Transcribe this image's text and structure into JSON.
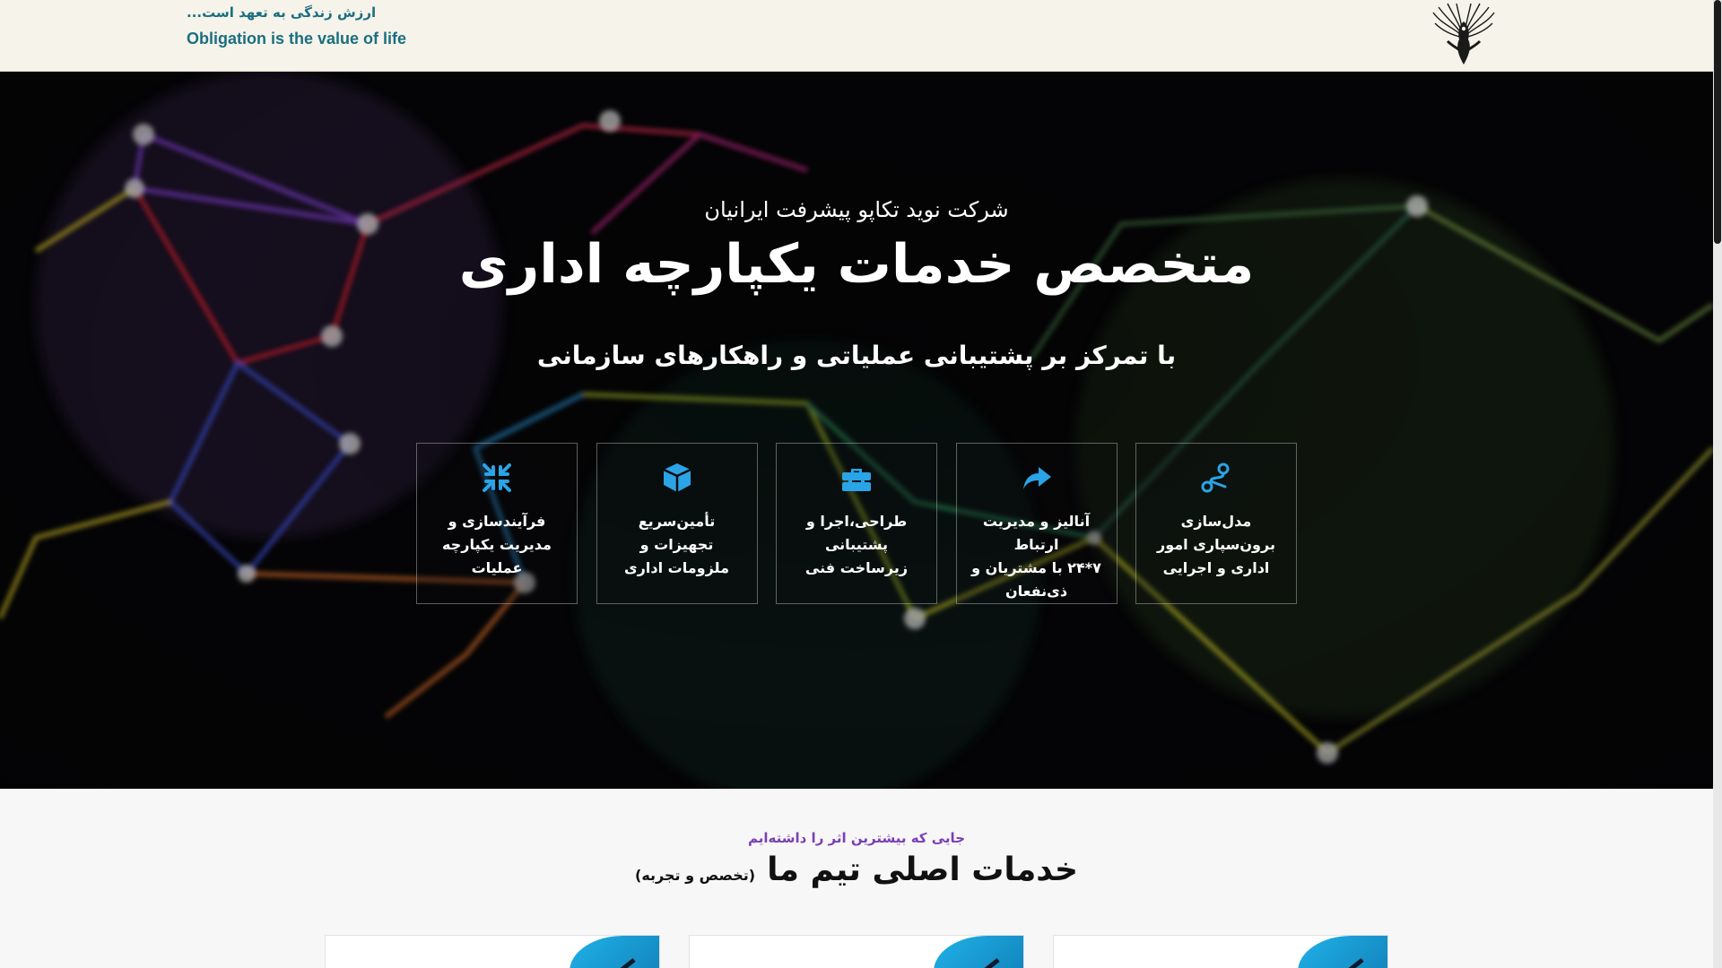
{
  "header": {
    "tagline_fa": "ارزش زندگی به تعهد است...",
    "tagline_en": "Obligation is the value of life",
    "logo_icon": "phoenix-emblem-icon"
  },
  "hero": {
    "company_name": "شرکت نوید تکاپو پیشرفت ایرانیان",
    "title": "متخصص خدمات یکپارچه اداری",
    "focus": "با تمرکز بر پشتیبانی عملیاتی و راهکارهای سازمانی",
    "features": [
      {
        "icon": "route-icon",
        "label": "مدل‌سازی\nبرون‌سپاری امور\nاداری و اجرایی"
      },
      {
        "icon": "share-arrow-icon",
        "label": "آنالیز و مدیریت ارتباط\n۷*۲۴ با مشتریان و\nذی‌نفعان"
      },
      {
        "icon": "toolbox-icon",
        "label": "طراحی،اجرا و\nپشتیبانی\nزیرساخت فنی"
      },
      {
        "icon": "cube-icon",
        "label": "تأمین‌سریع\nتجهیزات و\nملزومات اداری"
      },
      {
        "icon": "compress-arrows-icon",
        "label": "فرآیندسازی و\nمدیریت یکپارچه\nعملیات"
      }
    ]
  },
  "services": {
    "eyebrow": "جایی که بیشترین اثر را داشته‌ایم",
    "title": "خدمات اصلی تیم ما",
    "note": "(تخصص و تجربه)"
  },
  "colors": {
    "accent_blue": "#2aa4e6",
    "tagline_teal": "#1a6f80",
    "eyebrow_purple": "#7b3fb5",
    "header_bg": "#f6f3ea"
  }
}
